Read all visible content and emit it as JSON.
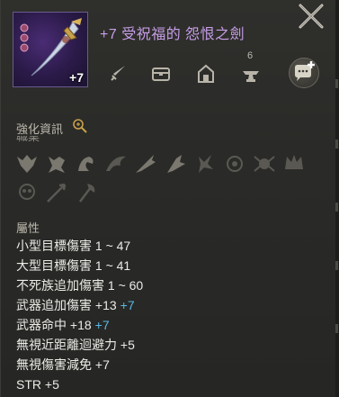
{
  "item": {
    "name": "+7 受祝福的 怨恨之劍",
    "enchant_level": "+7",
    "name_color": "#c79ee8",
    "thumb_icon": "cursed-scimitar-icon"
  },
  "actions": [
    {
      "name": "sword-icon"
    },
    {
      "name": "chest-icon"
    },
    {
      "name": "warehouse-icon"
    },
    {
      "name": "anvil-icon",
      "count": "6"
    },
    {
      "name": "chat-add-icon"
    }
  ],
  "enhancement": {
    "title": "強化資訊",
    "cut_text": "職業"
  },
  "runes": [
    "rune-demon-icon",
    "rune-beast-icon",
    "rune-dragon-icon",
    "rune-wing-icon",
    "rune-blade-icon",
    "rune-flame-icon",
    "rune-wolf-icon",
    "rune-orb-icon",
    "rune-spider-icon",
    "rune-crown-icon",
    "rune-skull-icon",
    "rune-arrow-icon",
    "rune-axe-icon"
  ],
  "attributes": {
    "title": "屬性",
    "items": [
      {
        "label": "小型目標傷害 1 ~ 47",
        "bonus": ""
      },
      {
        "label": "大型目標傷害 1 ~ 41",
        "bonus": ""
      },
      {
        "label": "不死族追加傷害 1 ~ 60",
        "bonus": ""
      },
      {
        "label": "武器追加傷害 +13",
        "bonus": "+7"
      },
      {
        "label": "武器命中 +18",
        "bonus": "+7"
      },
      {
        "label": "無視近距離迴避力 +5",
        "bonus": ""
      },
      {
        "label": "無視傷害減免 +7",
        "bonus": ""
      },
      {
        "label": "STR +5",
        "bonus": ""
      }
    ],
    "bonus_color": "#59b7e3"
  }
}
